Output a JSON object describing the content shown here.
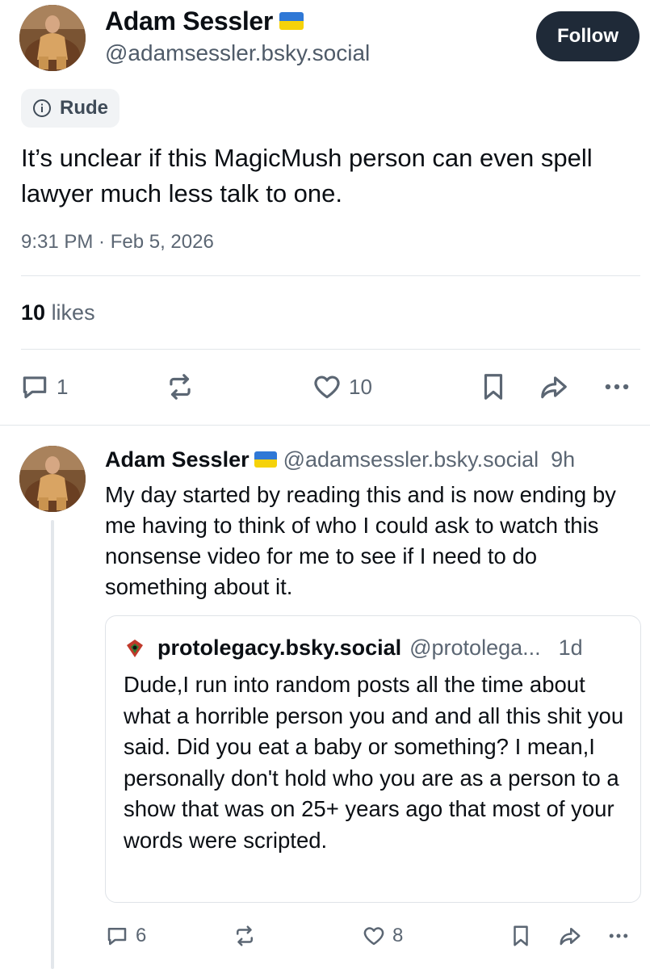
{
  "main_post": {
    "author": {
      "display_name": "Adam Sessler",
      "handle": "@adamsessler.bsky.social",
      "flag": "ukraine-flag"
    },
    "follow_label": "Follow",
    "content_label": "Rude",
    "text": "It’s unclear if this MagicMush person can even spell lawyer much less talk to one.",
    "timestamp": "9:31 PM · Feb 5, 2026",
    "likes_count": "10",
    "likes_label": "likes",
    "actions": {
      "replies": "1",
      "likes": "10"
    }
  },
  "reply_post": {
    "author": {
      "display_name": "Adam Sessler",
      "handle": "@adamsessler.bsky.social",
      "flag": "ukraine-flag"
    },
    "time": "9h",
    "text": "My day started by reading this and is now ending by me having to think of who I could ask to watch this nonsense video for me to see if I need to do something about it.",
    "quote": {
      "display_name": "protolegacy.bsky.social",
      "handle": "@protolega...",
      "time": "1d",
      "text": "Dude,I run into random posts all the time about what a horrible person you and and all this shit you said. Did you eat a baby or something? I mean,I personally don't hold who you are as a person to a show that was on 25+ years ago that most of your words were scripted."
    },
    "actions": {
      "replies": "6",
      "likes": "8"
    }
  },
  "colors": {
    "follow_bg": "#1f2a38",
    "muted_text": "#5b6673",
    "flag_blue": "#2f78d6",
    "flag_yellow": "#f5d20a"
  }
}
